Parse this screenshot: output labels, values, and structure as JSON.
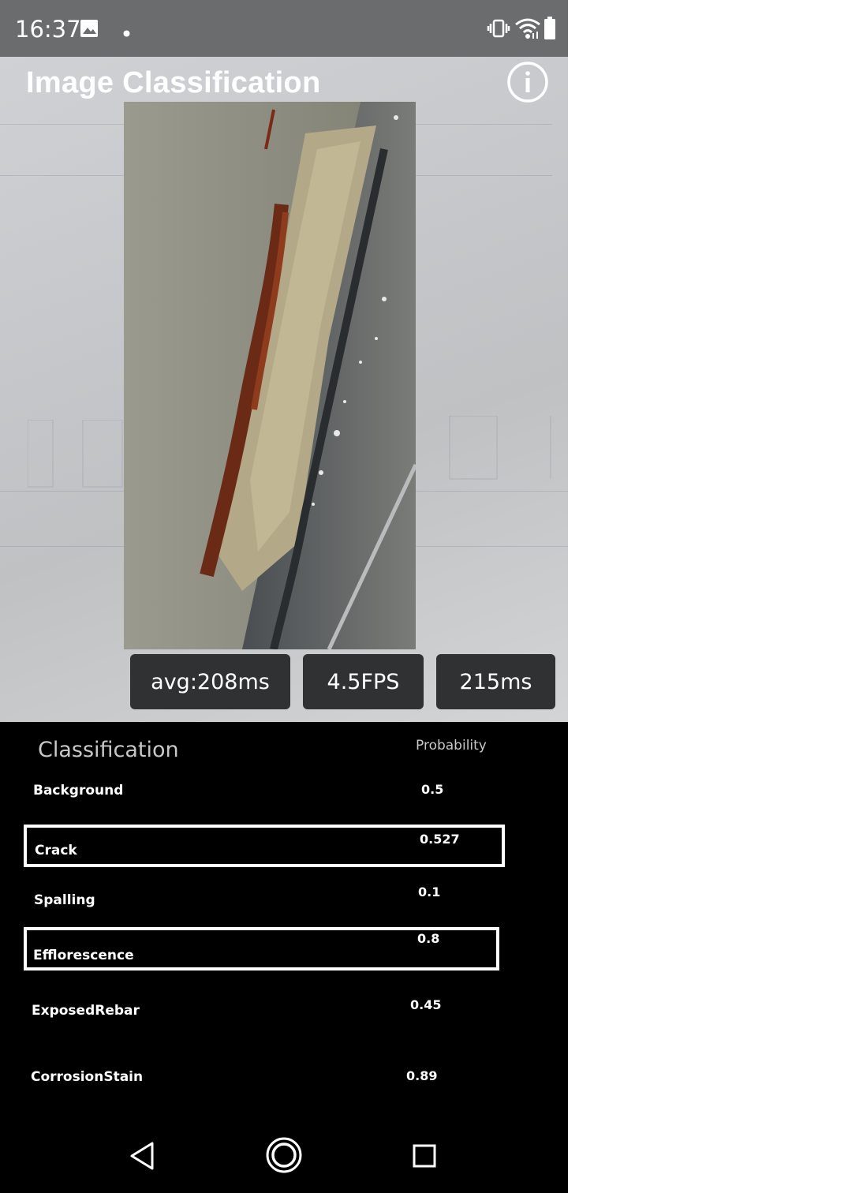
{
  "status_bar": {
    "time": "16:37",
    "icons": [
      "image-icon",
      "notification-dot-icon",
      "vibrate-icon",
      "wifi-icon",
      "battery-icon"
    ]
  },
  "app": {
    "title": "Image Classification",
    "info_icon": "info-icon"
  },
  "metrics": {
    "avg": "avg:208ms",
    "fps": "4.5FPS",
    "latency": "215ms"
  },
  "results": {
    "header_classification": "Classification",
    "header_probability": "Probability",
    "rows": [
      {
        "label": "Background",
        "probability": "0.5",
        "highlighted": false
      },
      {
        "label": "Crack",
        "probability": "0.527",
        "highlighted": true
      },
      {
        "label": "Spalling",
        "probability": "0.1",
        "highlighted": false
      },
      {
        "label": "Efflorescence",
        "probability": "0.8",
        "highlighted": true
      },
      {
        "label": "ExposedRebar",
        "probability": "0.45",
        "highlighted": false
      },
      {
        "label": "CorrosionStain",
        "probability": "0.89",
        "highlighted": false
      }
    ]
  },
  "nav_bar": {
    "buttons": [
      "back-icon",
      "home-icon",
      "recents-icon"
    ]
  },
  "colors": {
    "status_bar_bg": "#6b6c6e",
    "metric_bg": "#2f3133",
    "results_bg": "#000000",
    "text_primary": "#ffffff",
    "text_header": "#c8c8c8"
  }
}
